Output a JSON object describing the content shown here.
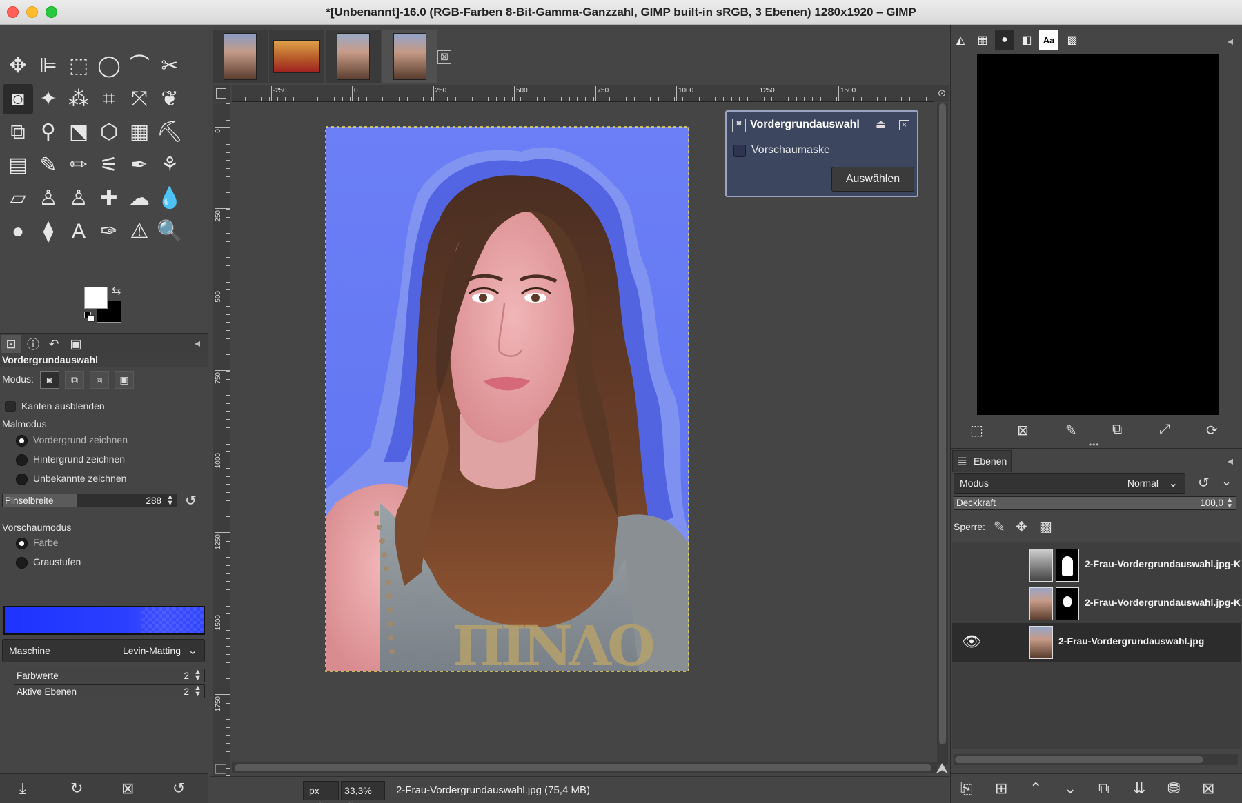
{
  "window": {
    "title": "*[Unbenannt]-16.0 (RGB-Farben 8-Bit-Gamma-Ganzzahl, GIMP built-in sRGB, 3 Ebenen) 1280x1920 – GIMP"
  },
  "toolbox": {
    "tools_icons": [
      "move-icon",
      "align-icon",
      "rect-select-icon",
      "ellipse-select-icon",
      "free-select-icon",
      "scissors-icon",
      "foreground-select-icon",
      "fuzzy-select-icon",
      "by-color-select-icon",
      "crop-icon",
      "transform-icon",
      "warp-icon",
      "unified-transform-icon",
      "handle-transform-icon",
      "perspective-icon",
      "3d-transform-icon",
      "cage-icon",
      "bucket-fill-icon",
      "gradient-icon",
      "paintbrush-icon",
      "pencil-icon",
      "airbrush-icon",
      "ink-icon",
      "mypaint-icon",
      "eraser-icon",
      "clone-icon",
      "perspective-clone-icon",
      "heal-icon",
      "smudge-icon",
      "blur-icon",
      "dodge-icon",
      "paths-icon",
      "text-icon",
      "color-picker-icon",
      "measure-icon",
      "zoom-icon"
    ],
    "tool_glyphs": [
      "✥",
      "⊫",
      "⬚",
      "◯",
      "⌒",
      "✂",
      "◙",
      "✦",
      "⁂",
      "⌗",
      "⤧",
      "❦",
      "⧉",
      "⚲",
      "⬔",
      "⬡",
      "▦",
      "⛏",
      "▤",
      "✎",
      "✏",
      "⚟",
      "✒",
      "⚘",
      "▱",
      "♙",
      "♙",
      "✚",
      "☁",
      "💧",
      "●",
      "⧫",
      "A",
      "✑",
      "⚠",
      "🔍"
    ],
    "foreground_color": "#ffffff",
    "background_color": "#000000"
  },
  "tool_options": {
    "title": "Vordergrundauswahl",
    "modus_label": "Modus:",
    "hide_edges_label": "Kanten ausblenden",
    "paint_mode_label": "Malmodus",
    "paint_modes": [
      "Vordergrund zeichnen",
      "Hintergrund zeichnen",
      "Unbekannte zeichnen"
    ],
    "stroke_width_label": "Pinselbreite",
    "stroke_width_value": "288",
    "preview_mode_label": "Vorschaumodus",
    "preview_modes": [
      "Farbe",
      "Graustufen"
    ],
    "mask_color": "#2038ff",
    "engine_label": "Maschine",
    "engine_value": "Levin-Matting",
    "levels_label": "Farbwerte",
    "levels_value": "2",
    "active_levels_label": "Aktive Ebenen",
    "active_levels_value": "2"
  },
  "image_tabs": [
    "thumb-1",
    "thumb-2",
    "thumb-3",
    "thumb-4"
  ],
  "ruler": {
    "h_labels": [
      "-250",
      "0",
      "250",
      "500",
      "750",
      "1000",
      "1250",
      "1500"
    ],
    "v_labels": [
      "0",
      "250",
      "500",
      "750",
      "1000",
      "1250",
      "1500",
      "1750"
    ]
  },
  "fg_dialog": {
    "title": "Vordergrundauswahl",
    "preview_mask_label": "Vorschaumaske",
    "select_button": "Auswählen"
  },
  "statusbar": {
    "unit": "px",
    "zoom": "33,3%",
    "message": "2-Frau-Vordergrundauswahl.jpg (75,4 MB)"
  },
  "layers_panel": {
    "tab_label": "Ebenen",
    "mode_label": "Modus",
    "mode_value": "Normal",
    "opacity_label": "Deckkraft",
    "opacity_value": "100,0",
    "lock_label": "Sperre:",
    "layers": [
      {
        "name": "2-Frau-Vordergrundauswahl.jpg-K",
        "visible": false,
        "has_mask": true
      },
      {
        "name": "2-Frau-Vordergrundauswahl.jpg-K",
        "visible": false,
        "has_mask": true
      },
      {
        "name": "2-Frau-Vordergrundauswahl.jpg",
        "visible": true,
        "has_mask": false
      }
    ]
  }
}
